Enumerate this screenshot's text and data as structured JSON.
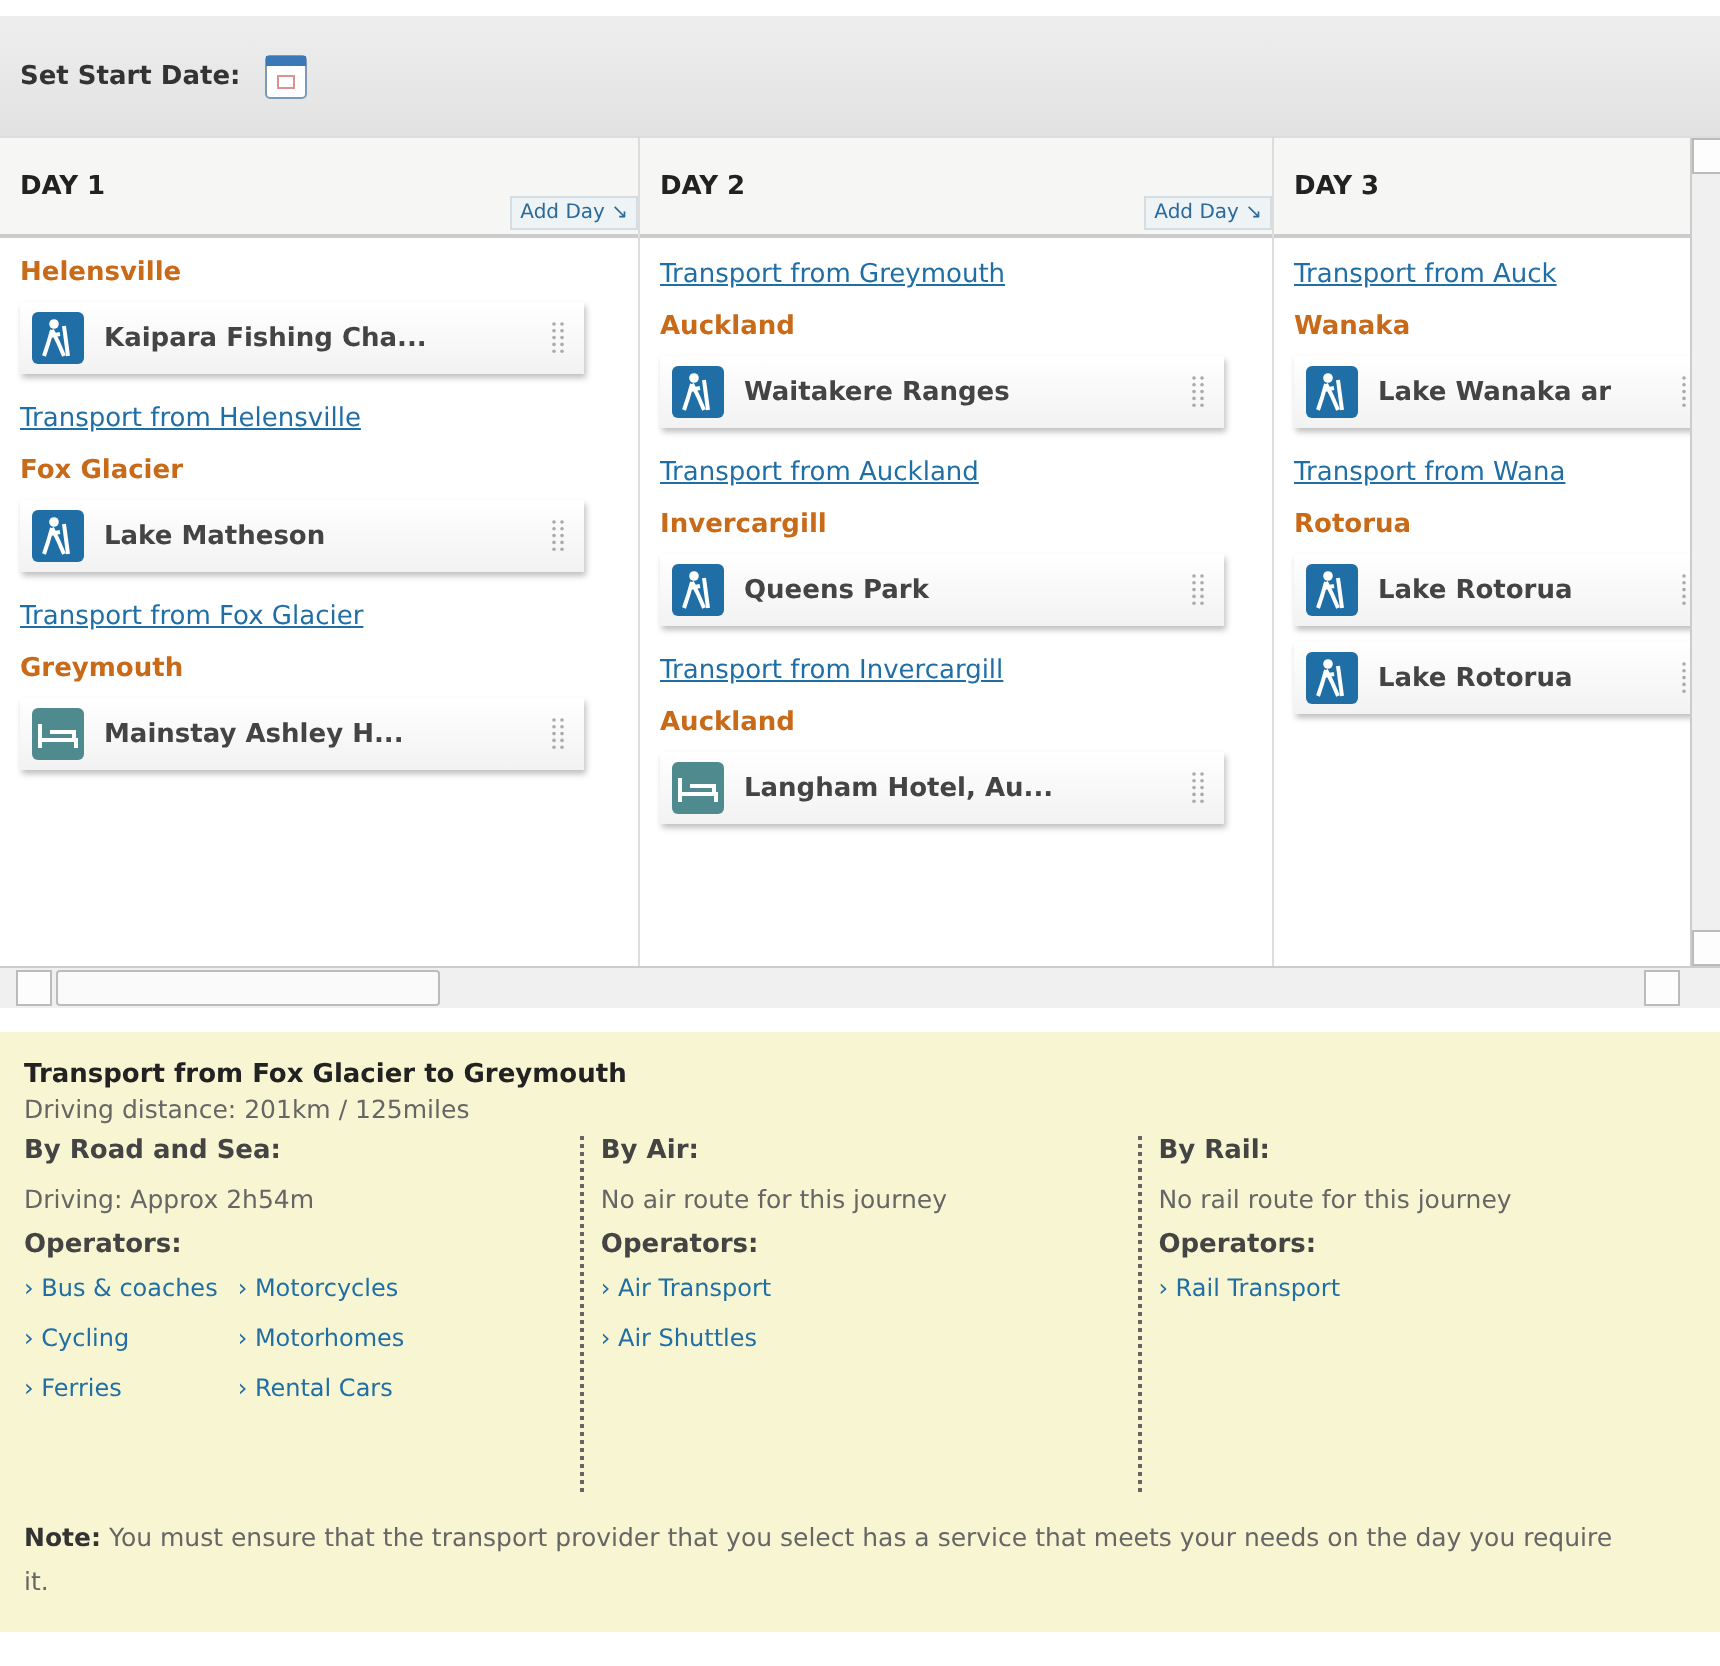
{
  "toolbar": {
    "label": "Set Start Date:"
  },
  "days": [
    {
      "title": "DAY 1",
      "add_day": "Add Day ↘",
      "items": [
        {
          "kind": "place",
          "text": "Helensville"
        },
        {
          "kind": "activity",
          "text": "Kaipara Fishing Cha..."
        },
        {
          "kind": "transport",
          "text": "Transport from Helensville"
        },
        {
          "kind": "place",
          "text": "Fox Glacier"
        },
        {
          "kind": "activity",
          "text": "Lake Matheson"
        },
        {
          "kind": "transport",
          "text": "Transport from Fox Glacier"
        },
        {
          "kind": "place",
          "text": "Greymouth"
        },
        {
          "kind": "lodging",
          "text": "Mainstay Ashley H..."
        }
      ]
    },
    {
      "title": "DAY 2",
      "add_day": "Add Day ↘",
      "items": [
        {
          "kind": "transport",
          "text": "Transport from Greymouth"
        },
        {
          "kind": "place",
          "text": "Auckland"
        },
        {
          "kind": "activity",
          "text": "Waitakere Ranges"
        },
        {
          "kind": "transport",
          "text": "Transport from Auckland"
        },
        {
          "kind": "place",
          "text": "Invercargill"
        },
        {
          "kind": "activity",
          "text": "Queens Park"
        },
        {
          "kind": "transport",
          "text": "Transport from Invercargill"
        },
        {
          "kind": "place",
          "text": "Auckland"
        },
        {
          "kind": "lodging",
          "text": "Langham Hotel, Au..."
        }
      ]
    },
    {
      "title": "DAY 3",
      "items": [
        {
          "kind": "transport",
          "text": "Transport from Auck"
        },
        {
          "kind": "place",
          "text": "Wanaka"
        },
        {
          "kind": "activity",
          "text": "Lake Wanaka ar"
        },
        {
          "kind": "transport",
          "text": "Transport from Wana"
        },
        {
          "kind": "place",
          "text": "Rotorua"
        },
        {
          "kind": "activity",
          "text": "Lake Rotorua"
        },
        {
          "kind": "activity",
          "text": "Lake Rotorua"
        }
      ]
    }
  ],
  "details": {
    "title": "Transport from Fox Glacier to Greymouth",
    "distance": "Driving distance: 201km / 125miles",
    "modes": [
      {
        "heading": "By Road and Sea:",
        "info": "Driving: Approx 2h54m",
        "operators_label": "Operators:",
        "operators": [
          "› Bus & coaches",
          "› Cycling",
          "› Ferries",
          "› Motorcycles",
          "› Motorhomes",
          "› Rental Cars"
        ]
      },
      {
        "heading": "By Air:",
        "info": "No air route for this journey",
        "operators_label": "Operators:",
        "operators": [
          "› Air Transport",
          "› Air Shuttles"
        ]
      },
      {
        "heading": "By Rail:",
        "info": "No rail route for this journey",
        "operators_label": "Operators:",
        "operators": [
          "› Rail Transport"
        ]
      }
    ],
    "note": "**Note:** You must ensure that the transport provider that you select has a service that meets your needs on the day you require it."
  }
}
